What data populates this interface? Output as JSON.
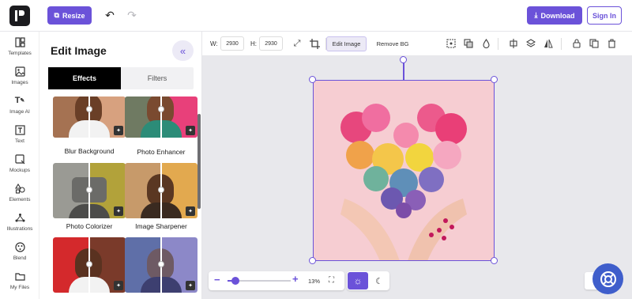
{
  "topbar": {
    "resize_label": "Resize",
    "download_label": "Download",
    "signin_label": "Sign In"
  },
  "rail": {
    "items": [
      {
        "label": "Templates",
        "icon": "templates-icon"
      },
      {
        "label": "Images",
        "icon": "images-icon"
      },
      {
        "label": "Image AI",
        "icon": "image-ai-icon"
      },
      {
        "label": "Text",
        "icon": "text-icon"
      },
      {
        "label": "Mockups",
        "icon": "mockups-icon"
      },
      {
        "label": "Elements",
        "icon": "elements-icon"
      },
      {
        "label": "Illustrations",
        "icon": "illustrations-icon"
      },
      {
        "label": "Blend",
        "icon": "blend-icon"
      },
      {
        "label": "My Files",
        "icon": "folder-icon"
      }
    ]
  },
  "panel": {
    "title": "Edit Image",
    "tabs": [
      {
        "label": "Effects",
        "active": true
      },
      {
        "label": "Filters",
        "active": false
      }
    ],
    "cards": [
      {
        "label": "Blur Background"
      },
      {
        "label": "Photo Enhancer"
      },
      {
        "label": "Photo Colorizer"
      },
      {
        "label": "Image Sharpener"
      },
      {
        "label": ""
      },
      {
        "label": ""
      }
    ]
  },
  "edit_toolbar": {
    "width_label": "W:",
    "width_value": "2930",
    "height_label": "H:",
    "height_value": "2930",
    "edit_image_label": "Edit Image",
    "remove_bg_label": "Remove BG"
  },
  "zoom": {
    "percent_label": "13%",
    "slider_fraction": 0.13
  },
  "colors": {
    "accent": "#6b52d9",
    "artboard_bg": "#f6cdd2",
    "help_button": "#3f5ecb"
  }
}
